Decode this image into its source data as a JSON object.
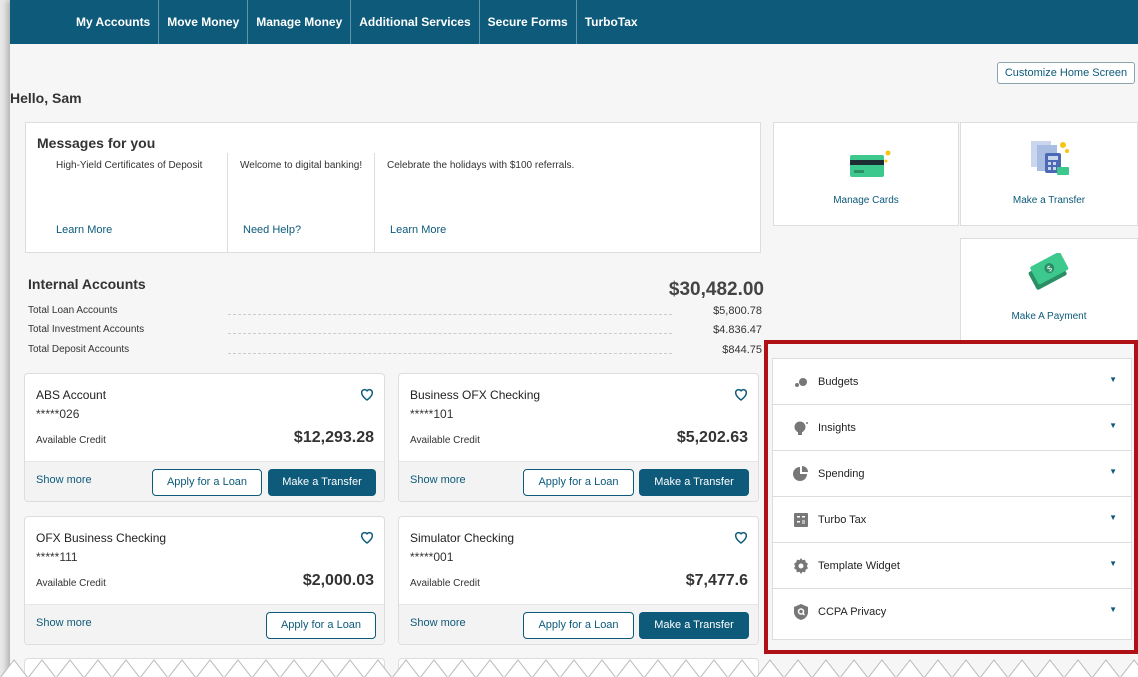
{
  "nav": {
    "items": [
      "My Accounts",
      "Move Money",
      "Manage Money",
      "Additional Services",
      "Secure Forms",
      "TurboTax"
    ]
  },
  "customize_label": "Customize Home Screen",
  "greeting": "Hello, Sam",
  "messages": {
    "title": "Messages for you",
    "items": [
      {
        "text": "High-Yield Certificates of Deposit",
        "link": "Learn More"
      },
      {
        "text": "Welcome to digital banking!",
        "link": "Need Help?"
      },
      {
        "text": "Celebrate the holidays with $100 referrals.",
        "link": "Learn More"
      }
    ]
  },
  "tiles": {
    "manage_cards": "Manage Cards",
    "make_transfer": "Make a Transfer",
    "make_payment": "Make A Payment"
  },
  "internal": {
    "title": "Internal Accounts",
    "total": "$30,482.00",
    "rows": [
      {
        "label": "Total Loan Accounts",
        "value": "$5,800.78"
      },
      {
        "label": "Total Investment Accounts",
        "value": "$4.836.47"
      },
      {
        "label": "Total Deposit Accounts",
        "value": "$844.75"
      }
    ]
  },
  "accounts": [
    {
      "name": "ABS Account",
      "number": "*****026",
      "credit_label": "Available Credit",
      "credit": "$12,293.28",
      "show_more": "Show more",
      "loan": "Apply for a Loan",
      "transfer": "Make a Transfer"
    },
    {
      "name": "Business OFX Checking",
      "number": "*****101",
      "credit_label": "Available Credit",
      "credit": "$5,202.63",
      "show_more": "Show more",
      "loan": "Apply for a Loan",
      "transfer": "Make a Transfer"
    },
    {
      "name": "OFX Business Checking",
      "number": "*****111",
      "credit_label": "Available Credit",
      "credit": "$2,000.03",
      "show_more": "Show more",
      "loan": "Apply for a Loan"
    },
    {
      "name": "Simulator Checking",
      "number": "*****001",
      "credit_label": "Available Credit",
      "credit": "$7,477.6",
      "show_more": "Show more",
      "loan": "Apply for a Loan",
      "transfer": "Make a Transfer"
    }
  ],
  "widgets": [
    {
      "label": "Budgets",
      "icon": "budgets-icon"
    },
    {
      "label": "Insights",
      "icon": "lightbulb-icon"
    },
    {
      "label": "Spending",
      "icon": "pie-chart-icon"
    },
    {
      "label": "Turbo Tax",
      "icon": "calculator-icon"
    },
    {
      "label": "Template Widget",
      "icon": "gear-icon"
    },
    {
      "label": "CCPA Privacy",
      "icon": "shield-icon"
    }
  ],
  "colors": {
    "brand": "#0d5a7a",
    "highlight_frame": "#b01116"
  }
}
